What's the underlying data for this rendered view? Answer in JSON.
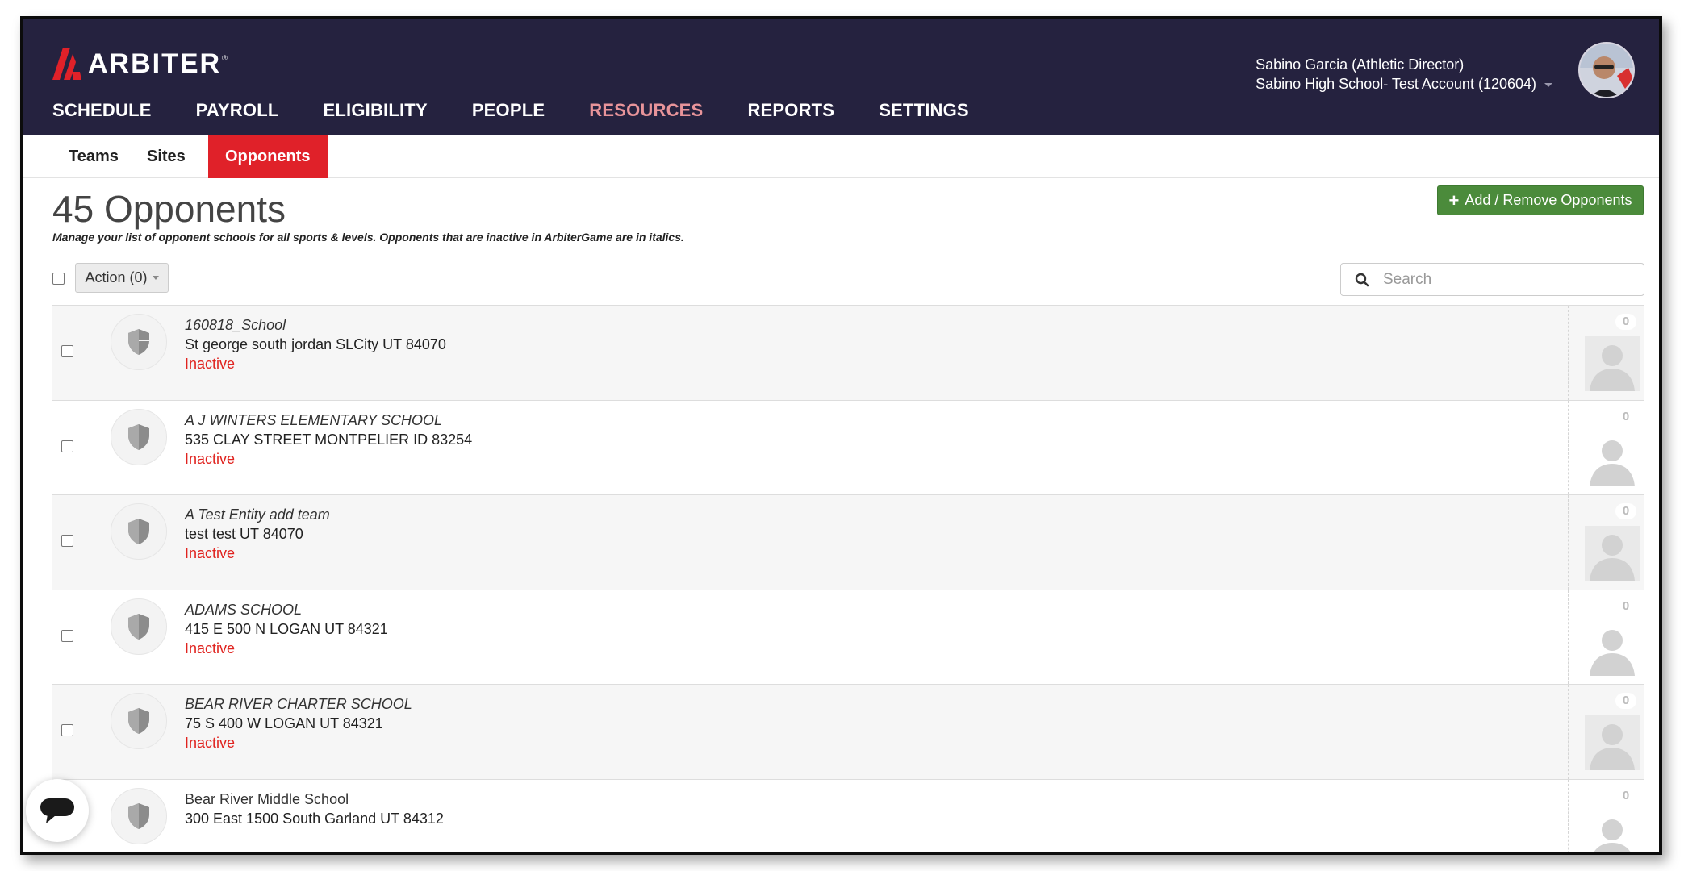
{
  "app": {
    "logo_text": "ARBITER",
    "logo_reg": "®"
  },
  "nav": {
    "items": [
      {
        "label": "SCHEDULE",
        "active": false
      },
      {
        "label": "PAYROLL",
        "active": false
      },
      {
        "label": "ELIGIBILITY",
        "active": false
      },
      {
        "label": "PEOPLE",
        "active": false
      },
      {
        "label": "RESOURCES",
        "active": true
      },
      {
        "label": "REPORTS",
        "active": false
      },
      {
        "label": "SETTINGS",
        "active": false
      }
    ]
  },
  "user": {
    "name_role": "Sabino Garcia (Athletic Director)",
    "account": "Sabino High School- Test Account (120604)"
  },
  "subnav": {
    "teams": "Teams",
    "sites": "Sites",
    "opponents": "Opponents"
  },
  "page": {
    "title": "45 Opponents",
    "description": "Manage your list of opponent schools for all sports & levels. Opponents that are inactive in ArbiterGame are in italics.",
    "add_button": "Add / Remove Opponents"
  },
  "toolbar": {
    "action_label": "Action (0)",
    "search_placeholder": "Search"
  },
  "opponents": [
    {
      "name": "160818_School",
      "address": "St george south jordan SLCity UT 84070",
      "status": "Inactive",
      "count": "0"
    },
    {
      "name": "A J WINTERS ELEMENTARY SCHOOL",
      "address": "535 CLAY STREET MONTPELIER ID 83254",
      "status": "Inactive",
      "count": "0"
    },
    {
      "name": "A Test Entity add team",
      "address": "test test UT 84070",
      "status": "Inactive",
      "count": "0"
    },
    {
      "name": "ADAMS SCHOOL",
      "address": "415 E 500 N LOGAN UT 84321",
      "status": "Inactive",
      "count": "0"
    },
    {
      "name": "BEAR RIVER CHARTER SCHOOL",
      "address": "75 S 400 W LOGAN UT 84321",
      "status": "Inactive",
      "count": "0"
    },
    {
      "name": "Bear River Middle School",
      "address": "300 East 1500 South Garland UT 84312",
      "status": "",
      "count": "0"
    }
  ],
  "colors": {
    "header_bg": "#25223f",
    "active_nav": "#e8949a",
    "accent_red": "#e02129",
    "add_button_green": "#4b8b3b",
    "inactive_text": "#e0231f"
  },
  "icons": {
    "logo": "arbiter-logo-icon",
    "badge": "shield-icon",
    "search": "search-icon",
    "plus": "plus-icon",
    "person": "person-placeholder-icon",
    "chat": "chat-icon"
  }
}
